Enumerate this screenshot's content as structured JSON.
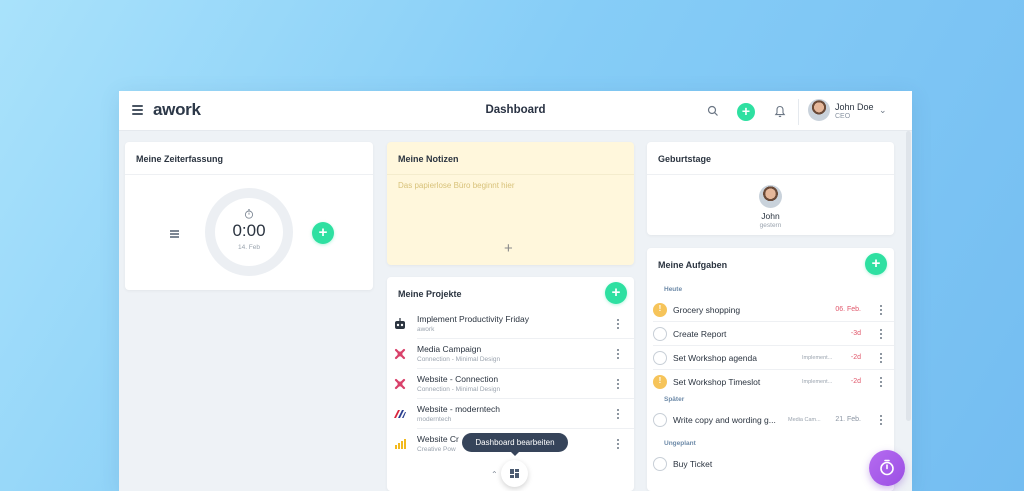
{
  "app": {
    "logo": "awork",
    "title": "Dashboard"
  },
  "user": {
    "name": "John Doe",
    "role": "CEO"
  },
  "colors": {
    "accent_green": "#2ee0a1",
    "note_bg": "#fff7dc",
    "fab_purple": "#a45de9",
    "priority_yellow": "#f6c45a",
    "overdue_red": "#e0566a"
  },
  "icons": {
    "menu": "hamburger-icon",
    "search": "search-icon",
    "add": "plus-icon",
    "notifications": "bell-icon",
    "dropdown": "chevron-down-icon",
    "timer": "stopwatch-icon",
    "dashboard_edit": "grid-icon"
  },
  "zeiterfassung": {
    "title": "Meine Zeiterfassung",
    "timer_value": "0:00",
    "timer_date": "14. Feb",
    "add_label": "+"
  },
  "notizen": {
    "title": "Meine Notizen",
    "placeholder": "Das papierlose Büro beginnt hier",
    "add_label": "+"
  },
  "geburtstage": {
    "title": "Geburtstage",
    "name": "John",
    "when": "gestern"
  },
  "projekte": {
    "title": "Meine Projekte",
    "add_label": "+",
    "items": [
      {
        "name": "Implement Productivity Friday",
        "sub": "awork"
      },
      {
        "name": "Media Campaign",
        "sub": "Connection - Minimal Design"
      },
      {
        "name": "Website - Connection",
        "sub": "Connection - Minimal Design"
      },
      {
        "name": "Website - moderntech",
        "sub": "moderntech"
      },
      {
        "name": "Website Cr",
        "sub": "Creative Pow"
      }
    ]
  },
  "dashboard_edit": {
    "tooltip": "Dashboard bearbeiten"
  },
  "aufgaben": {
    "title": "Meine Aufgaben",
    "add_label": "+",
    "sections": {
      "today": "Heute",
      "later": "Später",
      "unplanned": "Ungeplant"
    },
    "tasks": [
      {
        "name": "Grocery shopping",
        "project": "",
        "date": "06. Feb."
      },
      {
        "name": "Create Report",
        "project": "",
        "date": "-3d"
      },
      {
        "name": "Set Workshop agenda",
        "project": "Implement...",
        "date": "-2d"
      },
      {
        "name": "Set Workshop Timeslot",
        "project": "Implement...",
        "date": "-2d"
      },
      {
        "name": "Write copy and wording g...",
        "project": "Media Cam...",
        "date": "21. Feb."
      },
      {
        "name": "Buy Ticket",
        "project": "",
        "date": ""
      }
    ]
  }
}
